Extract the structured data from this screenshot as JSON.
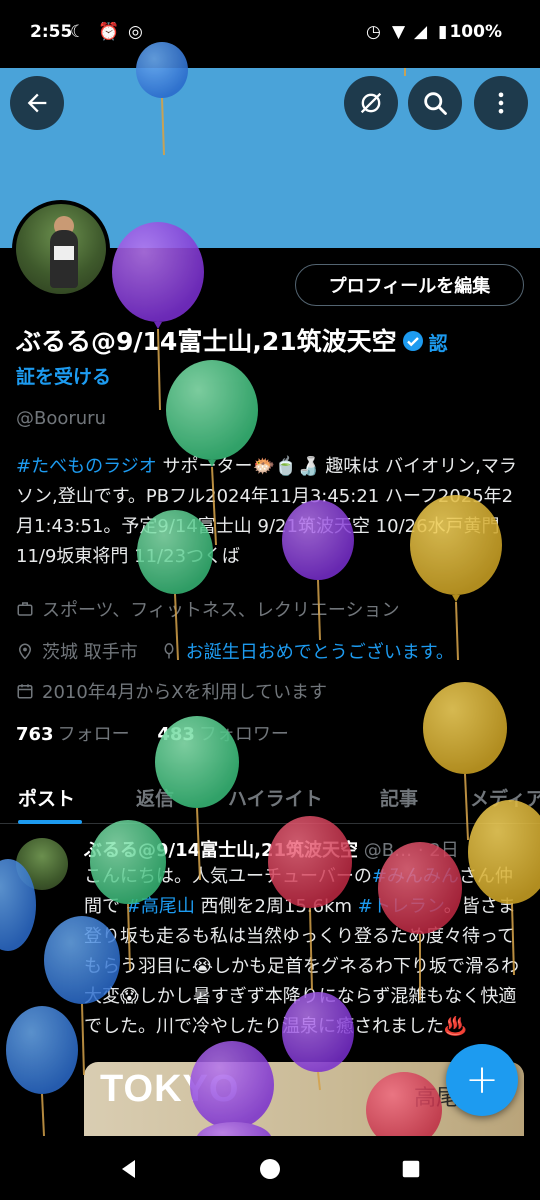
{
  "status_bar": {
    "time": "2:55",
    "battery": "100%"
  },
  "profile": {
    "edit_button": "プロフィールを編集",
    "name": "ぶるる@9/14富士山,21筑波天空",
    "verify_part1": "認",
    "verify_part2": "証を受ける",
    "handle": "@Booruru",
    "bio": {
      "tag": "#たべものラジオ",
      "line1_rest": " サポーター🐡🍵🍶 趣味は バイオリン,マラソン,登山です。PBフル2024年11月3:45:21 ハーフ2025年2月1:43:51。予定9/14富士山 9/21筑波天空 10/26水戸黄門 11/9坂東将門 11/23つくば"
    },
    "category": "スポーツ、フィットネス、レクリエーション",
    "location": "茨城 取手市",
    "birthday": "お誕生日おめでとうございます。",
    "joined": "2010年4月からXを利用しています",
    "following_count": "763",
    "following_label": "フォロー",
    "followers_count": "483",
    "followers_label": "フォロワー"
  },
  "tabs": [
    "ポスト",
    "返信",
    "ハイライト",
    "記事",
    "メディア"
  ],
  "post": {
    "name": "ぶるる@9/14富士山,21筑波天空",
    "meta": " @B… · 2日",
    "text_a": "こんにちは。人気ユーチューバーの",
    "tag1": "#みんみん",
    "text_b": "さん仲間で ",
    "tag2": "#高尾山",
    "text_c": " 西側を2周15.6km ",
    "tag3": "#トレラン",
    "text_d": "。皆さま登り坂も走るも私は当然ゆっくり登るため度々待ってもらう羽目に😭しかも足首をグネるわ下り坂で滑るわ大変😱しかし暑すぎず本降りにならず混雑もなく快適でした。川で冷やしたり温泉に癒されました♨️",
    "image_text": "TOKYO",
    "image_text2": "高尾山"
  },
  "fab_label": "+",
  "colors": {
    "accent": "#1d9bf0",
    "banner": "#4aa3d9"
  }
}
